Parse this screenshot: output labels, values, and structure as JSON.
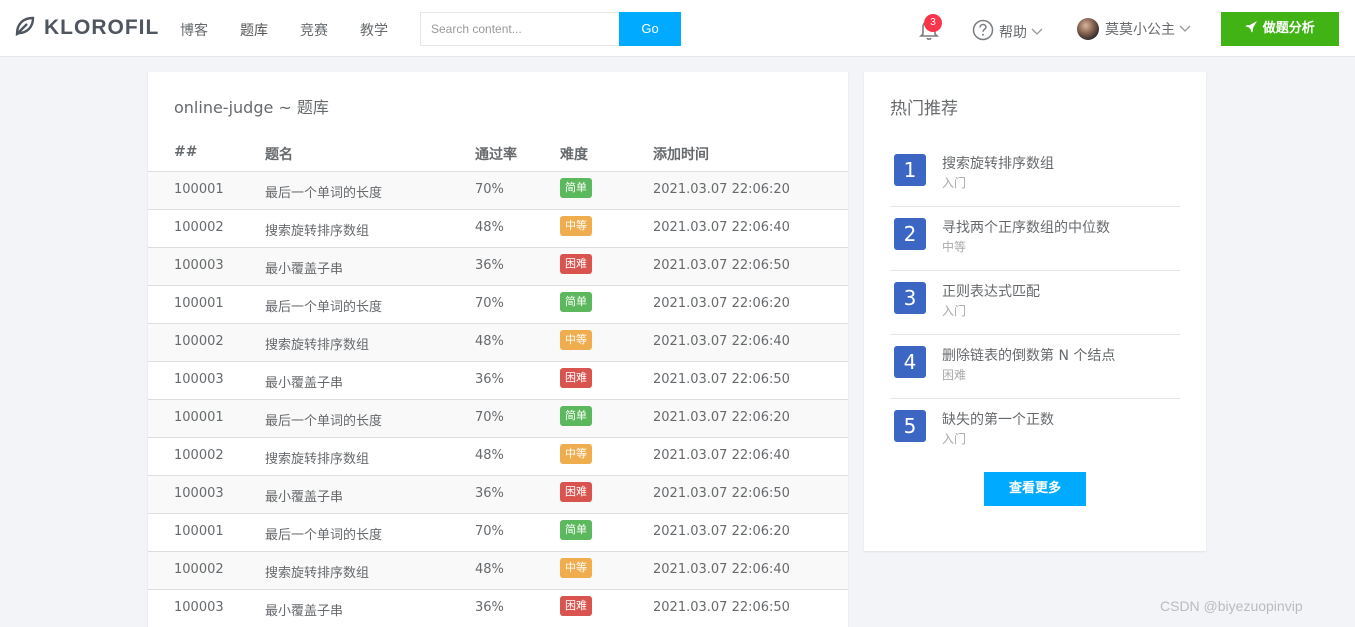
{
  "brand": {
    "name": "KLOROFIL",
    "logo_icon": "leaf-icon"
  },
  "nav": {
    "items": [
      {
        "label": "博客"
      },
      {
        "label": "题库"
      },
      {
        "label": "竞赛"
      },
      {
        "label": "教学"
      }
    ]
  },
  "search": {
    "placeholder": "Search content...",
    "button_label": "Go"
  },
  "notifications": {
    "count": "3"
  },
  "help": {
    "label": "帮助"
  },
  "user": {
    "name": "莫莫小公主"
  },
  "analyze_button": {
    "label": "做题分析"
  },
  "problem_list": {
    "title": "online-judge ~ 题库",
    "columns": [
      "##",
      "题名",
      "通过率",
      "难度",
      "添加时间"
    ],
    "rows": [
      {
        "id": "100001",
        "name": "最后一个单词的长度",
        "rate": "70%",
        "difficulty": "简单",
        "level": "easy",
        "time": "2021.03.07 22:06:20"
      },
      {
        "id": "100002",
        "name": "搜索旋转排序数组",
        "rate": "48%",
        "difficulty": "中等",
        "level": "medium",
        "time": "2021.03.07 22:06:40"
      },
      {
        "id": "100003",
        "name": "最小覆盖子串",
        "rate": "36%",
        "difficulty": "困难",
        "level": "hard",
        "time": "2021.03.07 22:06:50"
      },
      {
        "id": "100001",
        "name": "最后一个单词的长度",
        "rate": "70%",
        "difficulty": "简单",
        "level": "easy",
        "time": "2021.03.07 22:06:20"
      },
      {
        "id": "100002",
        "name": "搜索旋转排序数组",
        "rate": "48%",
        "difficulty": "中等",
        "level": "medium",
        "time": "2021.03.07 22:06:40"
      },
      {
        "id": "100003",
        "name": "最小覆盖子串",
        "rate": "36%",
        "difficulty": "困难",
        "level": "hard",
        "time": "2021.03.07 22:06:50"
      },
      {
        "id": "100001",
        "name": "最后一个单词的长度",
        "rate": "70%",
        "difficulty": "简单",
        "level": "easy",
        "time": "2021.03.07 22:06:20"
      },
      {
        "id": "100002",
        "name": "搜索旋转排序数组",
        "rate": "48%",
        "difficulty": "中等",
        "level": "medium",
        "time": "2021.03.07 22:06:40"
      },
      {
        "id": "100003",
        "name": "最小覆盖子串",
        "rate": "36%",
        "difficulty": "困难",
        "level": "hard",
        "time": "2021.03.07 22:06:50"
      },
      {
        "id": "100001",
        "name": "最后一个单词的长度",
        "rate": "70%",
        "difficulty": "简单",
        "level": "easy",
        "time": "2021.03.07 22:06:20"
      },
      {
        "id": "100002",
        "name": "搜索旋转排序数组",
        "rate": "48%",
        "difficulty": "中等",
        "level": "medium",
        "time": "2021.03.07 22:06:40"
      },
      {
        "id": "100003",
        "name": "最小覆盖子串",
        "rate": "36%",
        "difficulty": "困难",
        "level": "hard",
        "time": "2021.03.07 22:06:50"
      }
    ]
  },
  "difficulty_colors": {
    "easy": "#5cb85c",
    "medium": "#f0ad4e",
    "hard": "#d9534f"
  },
  "hot": {
    "title": "热门推荐",
    "items": [
      {
        "num": "1",
        "name": "搜索旋转排序数组",
        "level": "入门"
      },
      {
        "num": "2",
        "name": "寻找两个正序数组的中位数",
        "level": "中等"
      },
      {
        "num": "3",
        "name": "正则表达式匹配",
        "level": "入门"
      },
      {
        "num": "4",
        "name": "删除链表的倒数第 N 个结点",
        "level": "困难"
      },
      {
        "num": "5",
        "name": "缺失的第一个正数",
        "level": "入门"
      }
    ],
    "more_label": "查看更多"
  },
  "watermark": "CSDN @biyezuopinvip"
}
